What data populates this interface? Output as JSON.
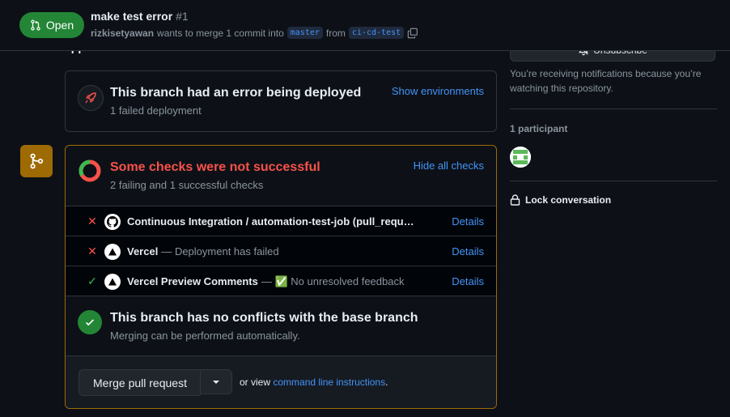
{
  "header": {
    "status": "Open",
    "title": "make test error",
    "number": "#1",
    "author": "rizkisetyawan",
    "merge_text": "wants to merge 1 commit into",
    "base_branch": "master",
    "from_text": "from",
    "head_branch": "ci-cd-test"
  },
  "cut_text": "app.",
  "deployment": {
    "title": "This branch had an error being deployed",
    "subtitle": "1 failed deployment",
    "action": "Show environments"
  },
  "checks": {
    "title": "Some checks were not successful",
    "subtitle": "2 failing and 1 successful checks",
    "action": "Hide all checks",
    "items": [
      {
        "status": "fail",
        "name": "Continuous Integration / automation-test-job (pull_requ…",
        "desc": "",
        "details": "Details"
      },
      {
        "status": "fail",
        "name": "Vercel",
        "desc": "— Deployment has failed",
        "details": "Details"
      },
      {
        "status": "pass",
        "name": "Vercel Preview Comments",
        "desc": "— ✅ No unresolved feedback",
        "details": "Details"
      }
    ]
  },
  "conflicts": {
    "title": "This branch has no conflicts with the base branch",
    "subtitle": "Merging can be performed automatically."
  },
  "merge": {
    "button": "Merge pull request",
    "or_view": "or view",
    "link": "command line instructions",
    "period": "."
  },
  "sidebar": {
    "unsubscribe": "Unsubscribe",
    "notification_text": "You’re receiving notifications because you’re watching this repository.",
    "participants": "1 participant",
    "lock": "Lock conversation"
  },
  "colors": {
    "open": "#238636",
    "fail": "#f85149",
    "pass": "#3fb950",
    "warning": "#9e6a03",
    "link": "#4493f8"
  }
}
